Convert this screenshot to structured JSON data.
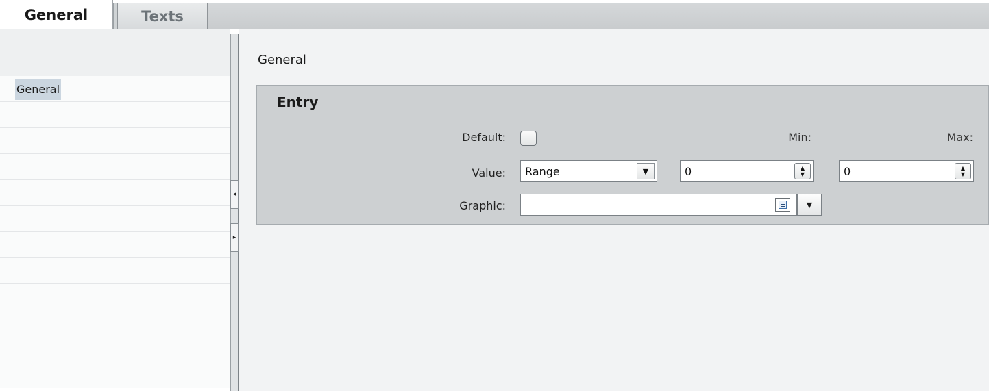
{
  "tabs": [
    {
      "label": "General",
      "active": true
    },
    {
      "label": "Texts",
      "active": false
    }
  ],
  "nav": {
    "items": [
      {
        "label": "General",
        "selected": true
      }
    ]
  },
  "splitter": {
    "collapse_glyph": "◂",
    "expand_glyph": "▸"
  },
  "main": {
    "section_title": "General",
    "group": {
      "title": "Entry",
      "default_label": "Default:",
      "default_checked": false,
      "min_label": "Min:",
      "max_label": "Max:",
      "value_label": "Value:",
      "value_selected": "Range",
      "min_value": "0",
      "max_value": "0",
      "graphic_label": "Graphic:",
      "graphic_value": ""
    }
  },
  "icons": {
    "dropdown": "▼",
    "spin_up": "▲",
    "spin_down": "▼",
    "list_icon": "list-icon"
  },
  "colors": {
    "selection": "#cbd6e0",
    "group_background": "#cdd0d2",
    "panel_background": "#f2f3f4"
  }
}
